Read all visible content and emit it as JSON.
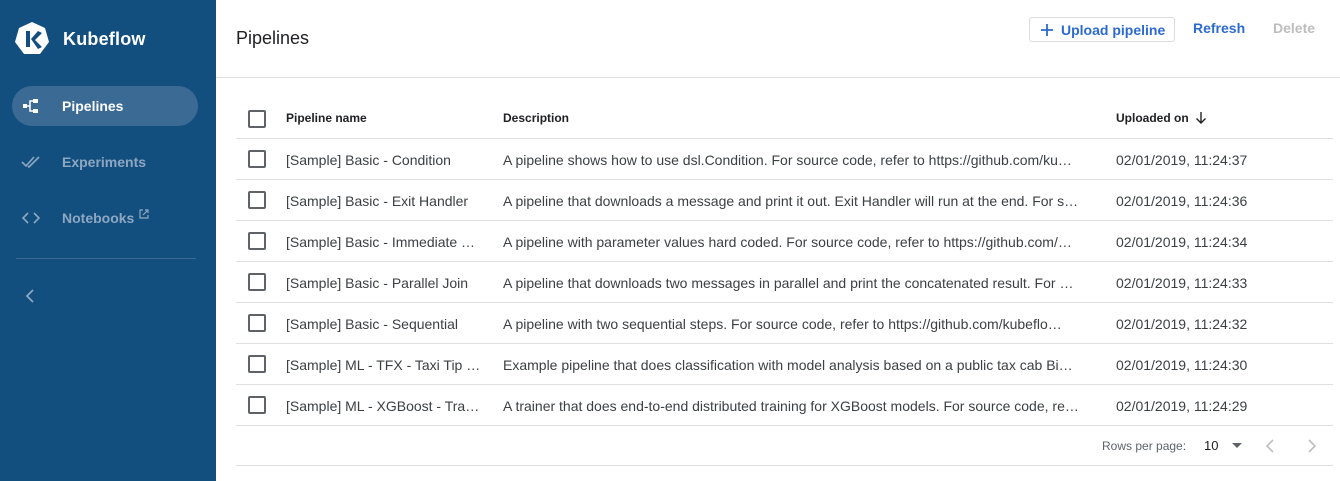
{
  "brand": {
    "name": "Kubeflow"
  },
  "sidebar": {
    "items": [
      {
        "label": "Pipelines",
        "icon": "pipelines-icon",
        "active": true
      },
      {
        "label": "Experiments",
        "icon": "experiments-icon",
        "active": false
      },
      {
        "label": "Notebooks",
        "icon": "notebooks-icon",
        "active": false,
        "external": true
      }
    ],
    "collapse_icon": "chevron-left-icon"
  },
  "header": {
    "title": "Pipelines",
    "upload_label": "Upload pipeline",
    "refresh_label": "Refresh",
    "delete_label": "Delete"
  },
  "table": {
    "columns": {
      "name": "Pipeline name",
      "description": "Description",
      "uploaded": "Uploaded on"
    },
    "sort": {
      "column": "uploaded",
      "direction": "desc"
    },
    "rows": [
      {
        "name": "[Sample] Basic - Condition",
        "description": "A pipeline shows how to use dsl.Condition. For source code, refer to https://github.com/ku…",
        "uploaded": "02/01/2019, 11:24:37"
      },
      {
        "name": "[Sample] Basic - Exit Handler",
        "description": "A pipeline that downloads a message and print it out. Exit Handler will run at the end. For s…",
        "uploaded": "02/01/2019, 11:24:36"
      },
      {
        "name": "[Sample] Basic - Immediate …",
        "description": "A pipeline with parameter values hard coded. For source code, refer to https://github.com/…",
        "uploaded": "02/01/2019, 11:24:34"
      },
      {
        "name": "[Sample] Basic - Parallel Join",
        "description": "A pipeline that downloads two messages in parallel and print the concatenated result. For …",
        "uploaded": "02/01/2019, 11:24:33"
      },
      {
        "name": "[Sample] Basic - Sequential",
        "description": "A pipeline with two sequential steps. For source code, refer to https://github.com/kubeflo…",
        "uploaded": "02/01/2019, 11:24:32"
      },
      {
        "name": "[Sample] ML - TFX - Taxi Tip …",
        "description": "Example pipeline that does classification with model analysis based on a public tax cab Bi…",
        "uploaded": "02/01/2019, 11:24:30"
      },
      {
        "name": "[Sample] ML - XGBoost - Trai…",
        "description": "A trainer that does end-to-end distributed training for XGBoost models. For source code, re…",
        "uploaded": "02/01/2019, 11:24:29"
      }
    ]
  },
  "pager": {
    "rows_per_page_label": "Rows per page:",
    "rows_per_page": "10"
  },
  "colors": {
    "sidebar_bg": "#124f7f",
    "sidebar_active": "#3b6a94",
    "accent": "#2b6ad0",
    "disabled": "#bdbdbd"
  }
}
